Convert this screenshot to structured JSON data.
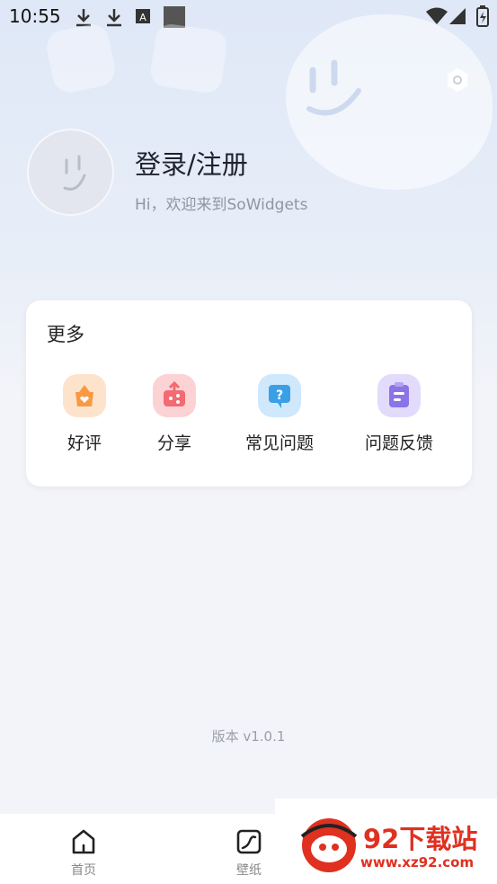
{
  "status_bar": {
    "time": "10:55"
  },
  "profile": {
    "title": "登录/注册",
    "greeting": "Hi，欢迎来到SoWidgets"
  },
  "more_section": {
    "title": "更多",
    "items": [
      {
        "label": "好评",
        "icon": "heart-bag-icon",
        "color": "#f79a43"
      },
      {
        "label": "分享",
        "icon": "share-icon",
        "color": "#f26a72"
      },
      {
        "label": "常见问题",
        "icon": "question-bubble-icon",
        "color": "#3aa0e6"
      },
      {
        "label": "问题反馈",
        "icon": "feedback-clipboard-icon",
        "color": "#8b73e8"
      }
    ]
  },
  "version_text": "版本 v1.0.1",
  "tab_bar": {
    "tabs": [
      {
        "label": "首页",
        "icon": "home-icon"
      },
      {
        "label": "壁纸",
        "icon": "wallpaper-icon"
      }
    ]
  },
  "watermark": {
    "text": "92下载站",
    "url": "www.xz92.com"
  }
}
